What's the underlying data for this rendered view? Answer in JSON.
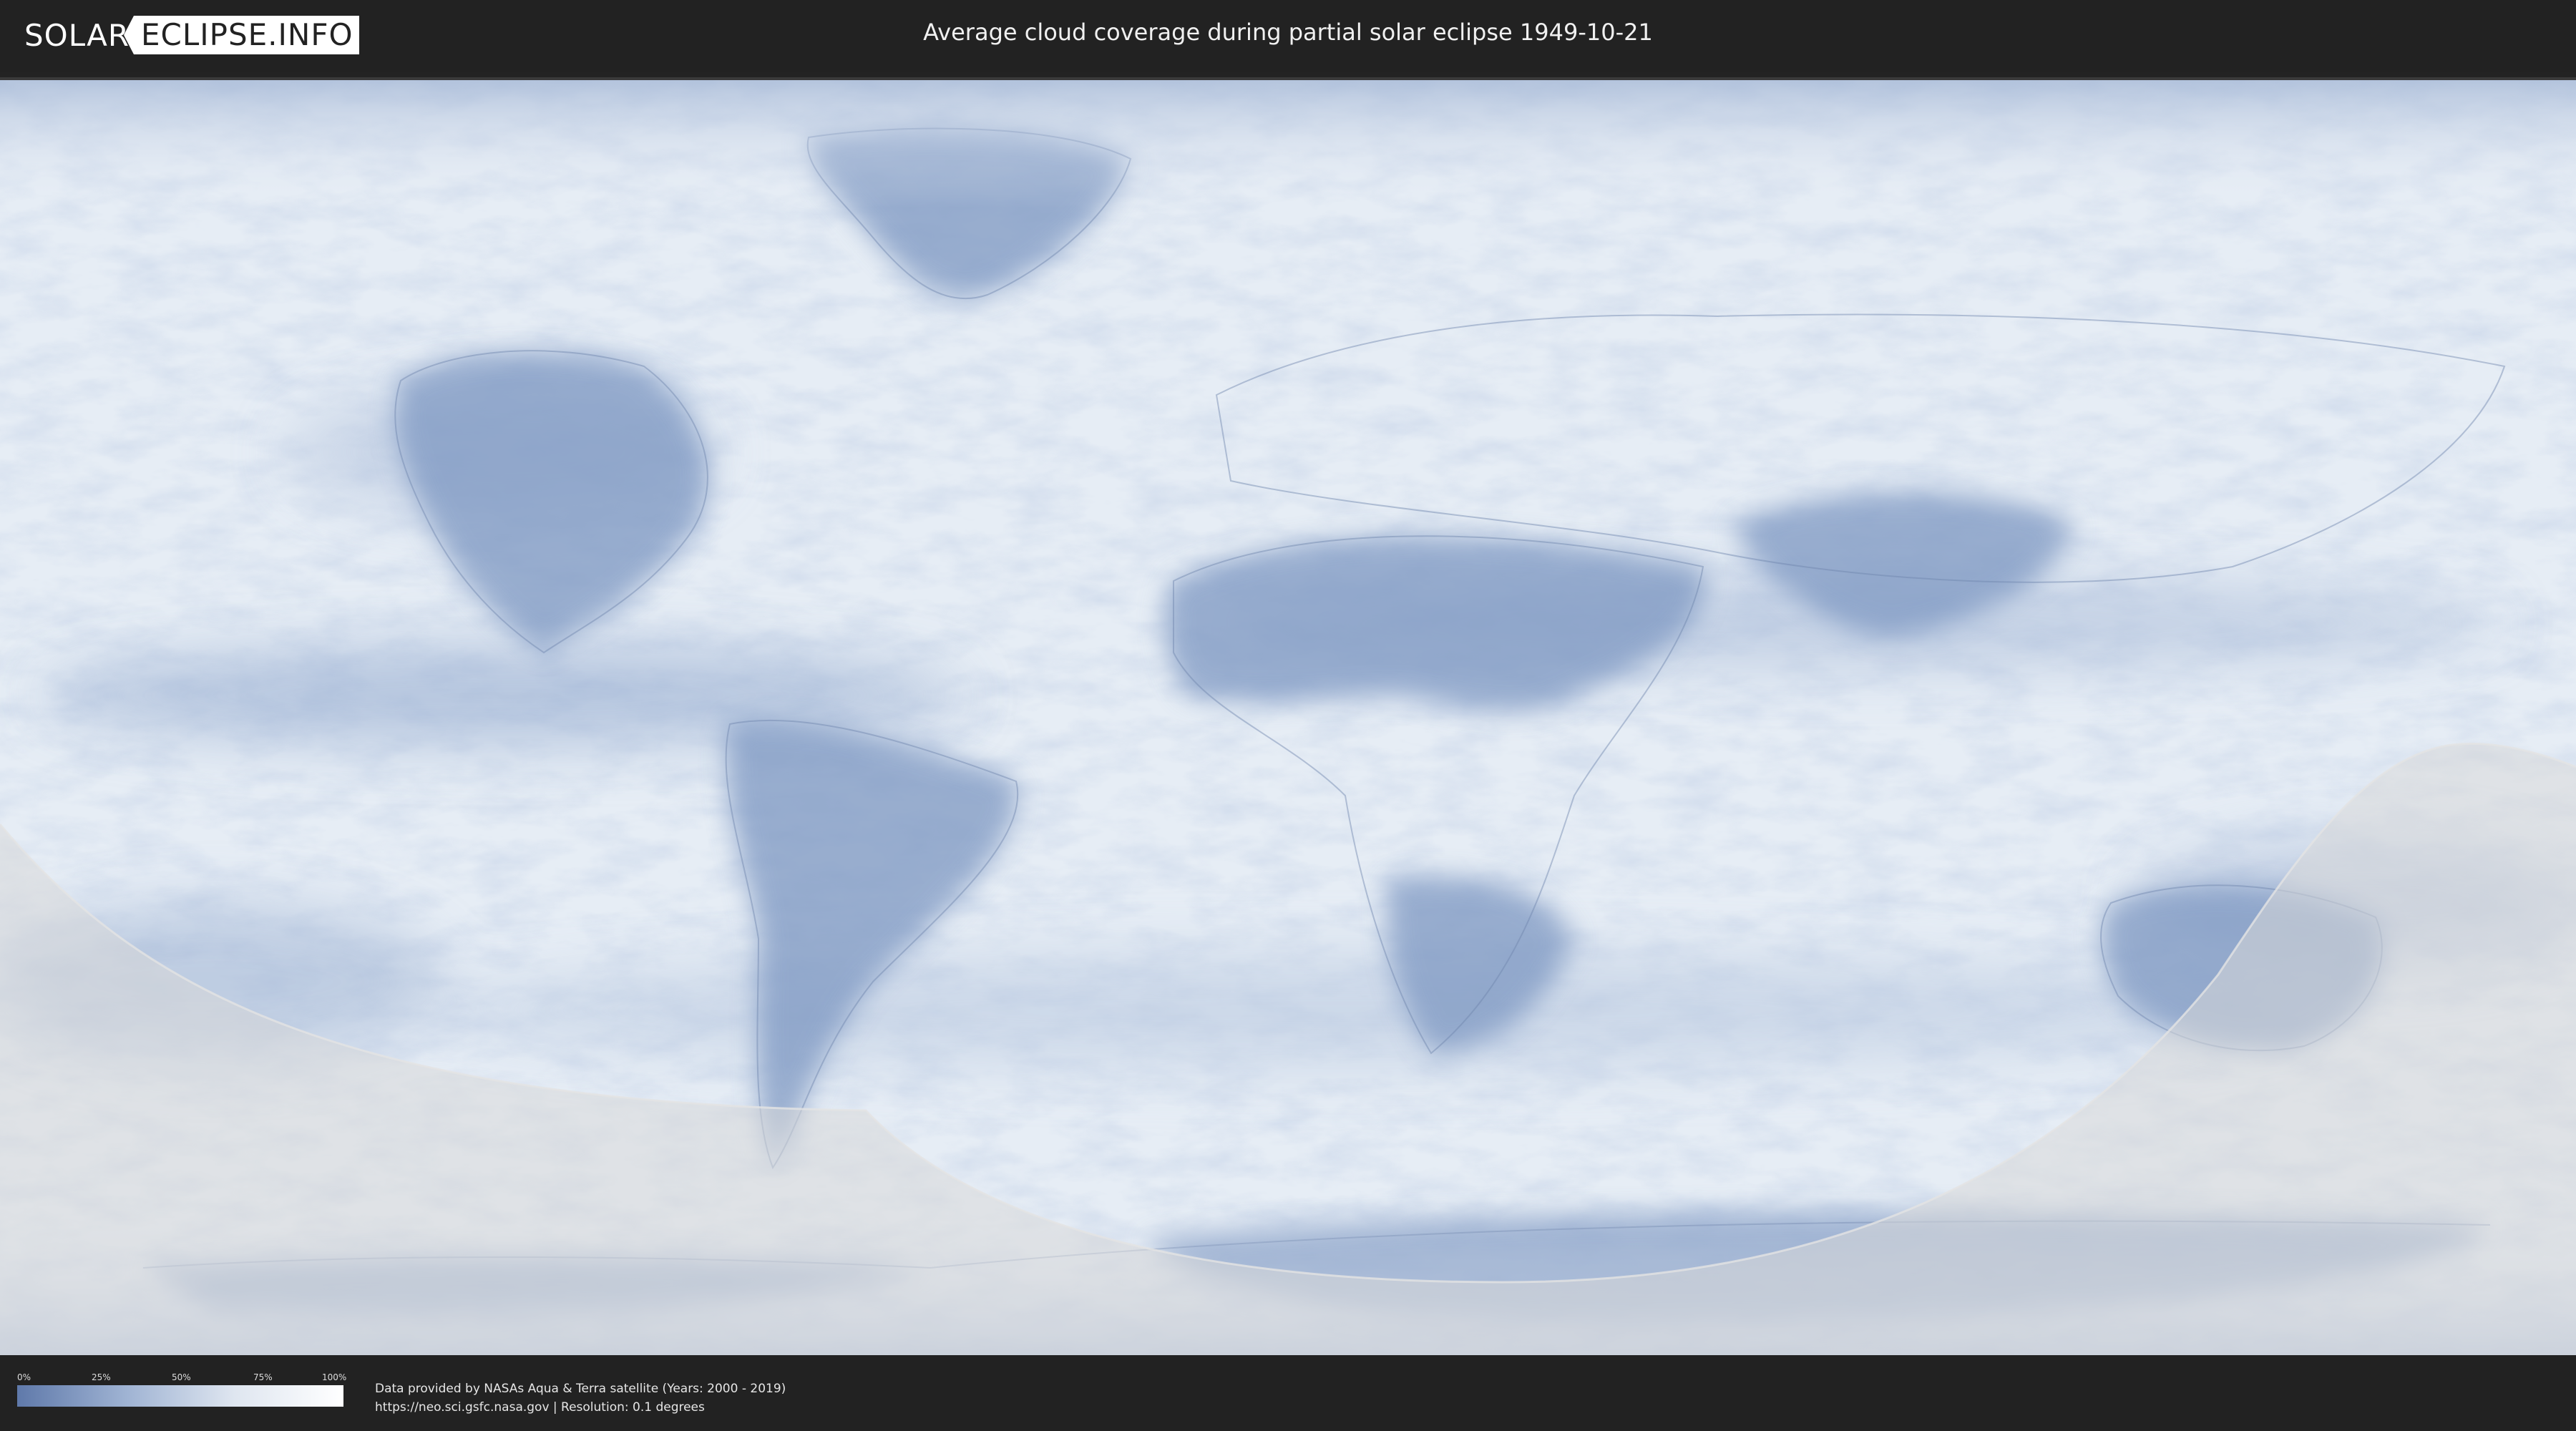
{
  "header": {
    "logo_left": "SOLAR",
    "logo_right": "ECLIPSE.INFO",
    "title": "Average cloud coverage during partial solar eclipse 1949-10-21"
  },
  "legend": {
    "ticks": [
      "0%",
      "25%",
      "50%",
      "75%",
      "100%"
    ],
    "colors": [
      "#5f79aa",
      "#9fb3d3",
      "#dfe6f0",
      "#ffffff"
    ]
  },
  "credits": {
    "line1": "Data provided by NASAs Aqua & Terra satellite (Years: 2000 - 2019)",
    "line2": "https://neo.sci.gsfc.nasa.gov | Resolution: 0.1 degrees"
  },
  "map": {
    "ocean_color": "#e4ebf4",
    "cloud_light": "#f6f8fb",
    "cloud_dark": "#7e98c2",
    "shadow_color": "#d8d8d8"
  }
}
